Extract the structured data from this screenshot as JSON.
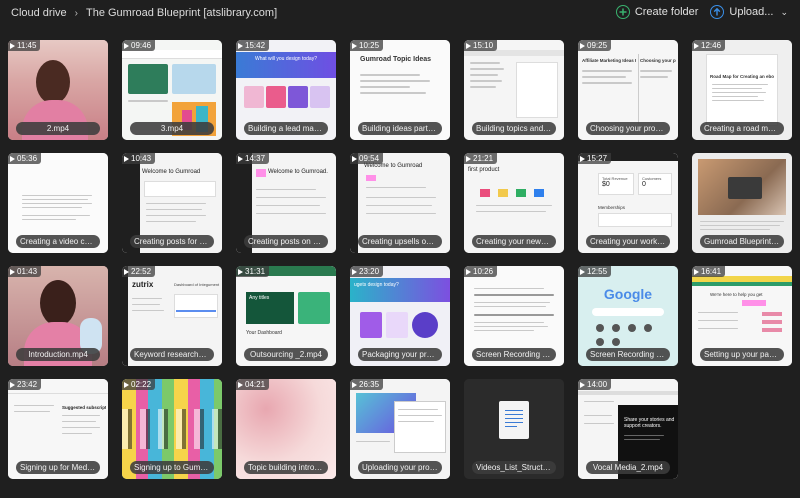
{
  "breadcrumb": {
    "root": "Cloud drive",
    "separator": "›",
    "current": "The Gumroad Blueprint [atslibrary.com]"
  },
  "toolbar": {
    "create_folder": "Create folder",
    "upload": "Upload...",
    "upload_caret": "⌄"
  },
  "files": [
    {
      "duration": "11:45",
      "name": "2.mp4"
    },
    {
      "duration": "09:46",
      "name": "3.mp4"
    },
    {
      "duration": "15:42",
      "name": "Building a lead magne..."
    },
    {
      "duration": "10:25",
      "name": "Building ideas part 1 _..."
    },
    {
      "duration": "15:10",
      "name": "Building topics and id..."
    },
    {
      "duration": "09:25",
      "name": "Choosing your produc..."
    },
    {
      "duration": "12:46",
      "name": "Creating a road map f..."
    },
    {
      "duration": "05:36",
      "name": "Creating a video cour..."
    },
    {
      "duration": "10:43",
      "name": "Creating posts for yo..."
    },
    {
      "duration": "14:37",
      "name": "Creating posts on Gu..."
    },
    {
      "duration": "09:54",
      "name": "Creating upsells on G..."
    },
    {
      "duration": "21:21",
      "name": "Creating your newsle..."
    },
    {
      "duration": "15:27",
      "name": "Creating your workflo..."
    },
    {
      "duration": "",
      "name": "Gumroad Blueprint S..."
    },
    {
      "duration": "01:43",
      "name": "Introduction.mp4"
    },
    {
      "duration": "22:52",
      "name": "Keyword research_2..."
    },
    {
      "duration": "31:31",
      "name": "Outsourcing _2.mp4"
    },
    {
      "duration": "23:20",
      "name": "Packaging your produ..."
    },
    {
      "duration": "10:26",
      "name": "Screen Recording 202..."
    },
    {
      "duration": "12:55",
      "name": "Screen Recording 202..."
    },
    {
      "duration": "16:41",
      "name": "Setting up your page_..."
    },
    {
      "duration": "23:42",
      "name": "Signing up for Mediu..."
    },
    {
      "duration": "02:22",
      "name": "Signing up to Gumroa..."
    },
    {
      "duration": "04:21",
      "name": "Topic building intro 2_..."
    },
    {
      "duration": "26:35",
      "name": "Uploading your produ..."
    },
    {
      "duration": "",
      "name": "Videos_List_Structure..."
    },
    {
      "duration": "14:00",
      "name": "Vocal Media_2.mp4"
    }
  ],
  "thumbnail_text": {
    "t4_title": "Gumroad Topic Ideas",
    "t3_heading": "What will you design today?",
    "t6_heading": "Affiliate Marketing Ideas F",
    "t6_heading2": "Choosing your p",
    "t7_heading": "Road Map for Creating an ebook",
    "t9_heading": "Welcome to Gumroad",
    "t10_heading": "Welcome to Gumroad.",
    "t11_heading": "Welcome to Gumroad",
    "t12_heading": "first product",
    "t13_total": "Total Revenue",
    "t13_value": "$0",
    "t13_customers": "Customers",
    "t13_cval": "0",
    "t13_memberships": "Memberships",
    "t16_logo": "zutrix",
    "t16_title": "Dashboard of Integument",
    "t17_heading": "Any titles",
    "t17_dash": "Your Dashboard",
    "t18_heading": "ugets design today?",
    "t20_logo": "Google",
    "t21_top": "We're here to help you get",
    "t22_heading": "Suggested subscriptions",
    "t27_line1": "Share your stories and",
    "t27_line2": "support creators."
  },
  "colors": {
    "background": "#1f1f1f",
    "create_folder_accent": "#39b26e",
    "upload_accent": "#3a8fe8",
    "gumroad_pink": "#ff90e8"
  },
  "icons": {
    "create_folder": "plus-circle-icon",
    "upload": "arrow-up-circle-icon",
    "play": "play-icon",
    "document": "document-icon"
  }
}
